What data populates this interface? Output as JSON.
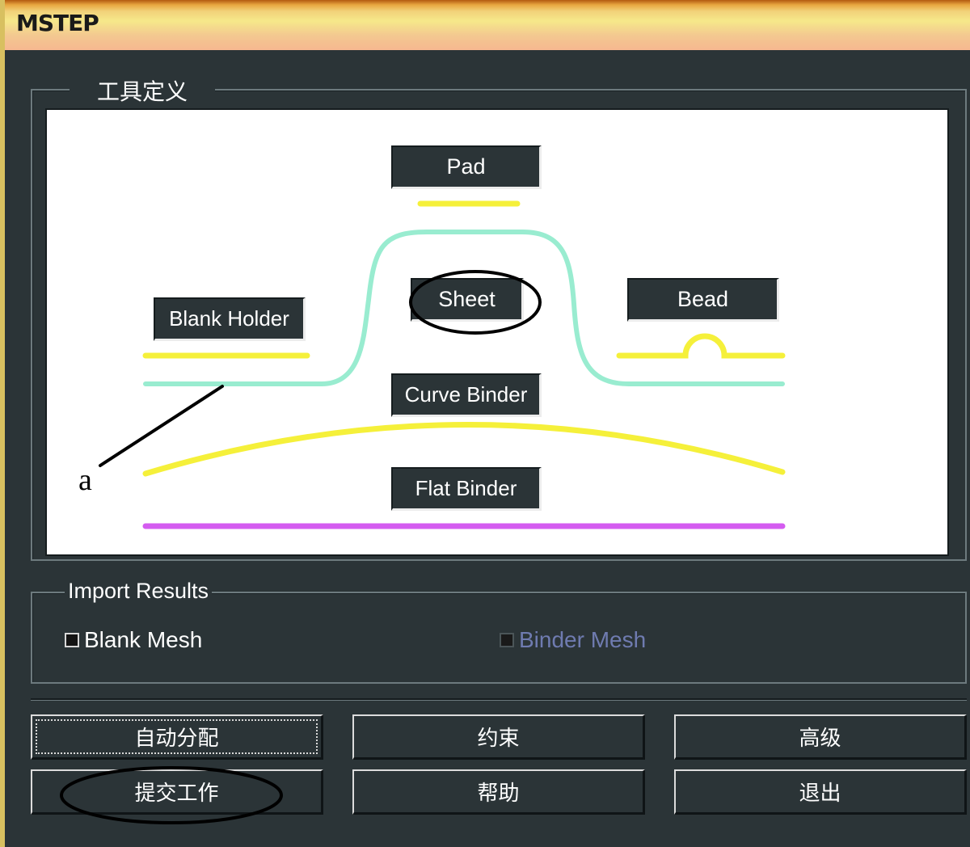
{
  "window": {
    "title": "MSTEP"
  },
  "tool_definition": {
    "legend": "工具定义",
    "labels": {
      "pad": "Pad",
      "sheet": "Sheet",
      "blank_holder": "Blank Holder",
      "bead": "Bead",
      "curve_binder": "Curve Binder",
      "flat_binder": "Flat Binder"
    },
    "annotation": "a",
    "colors": {
      "yellow": "#f5f03a",
      "cyan": "#99ecd0",
      "magenta": "#d45cf0"
    }
  },
  "import_results": {
    "legend": "Import Results",
    "blank_mesh": {
      "label": "Blank Mesh",
      "checked": false,
      "enabled": true
    },
    "binder_mesh": {
      "label": "Binder Mesh",
      "checked": false,
      "enabled": false
    }
  },
  "buttons": {
    "auto_assign": "自动分配",
    "constraint": "约束",
    "advanced": "高级",
    "submit_job": "提交工作",
    "help": "帮助",
    "exit": "退出"
  }
}
